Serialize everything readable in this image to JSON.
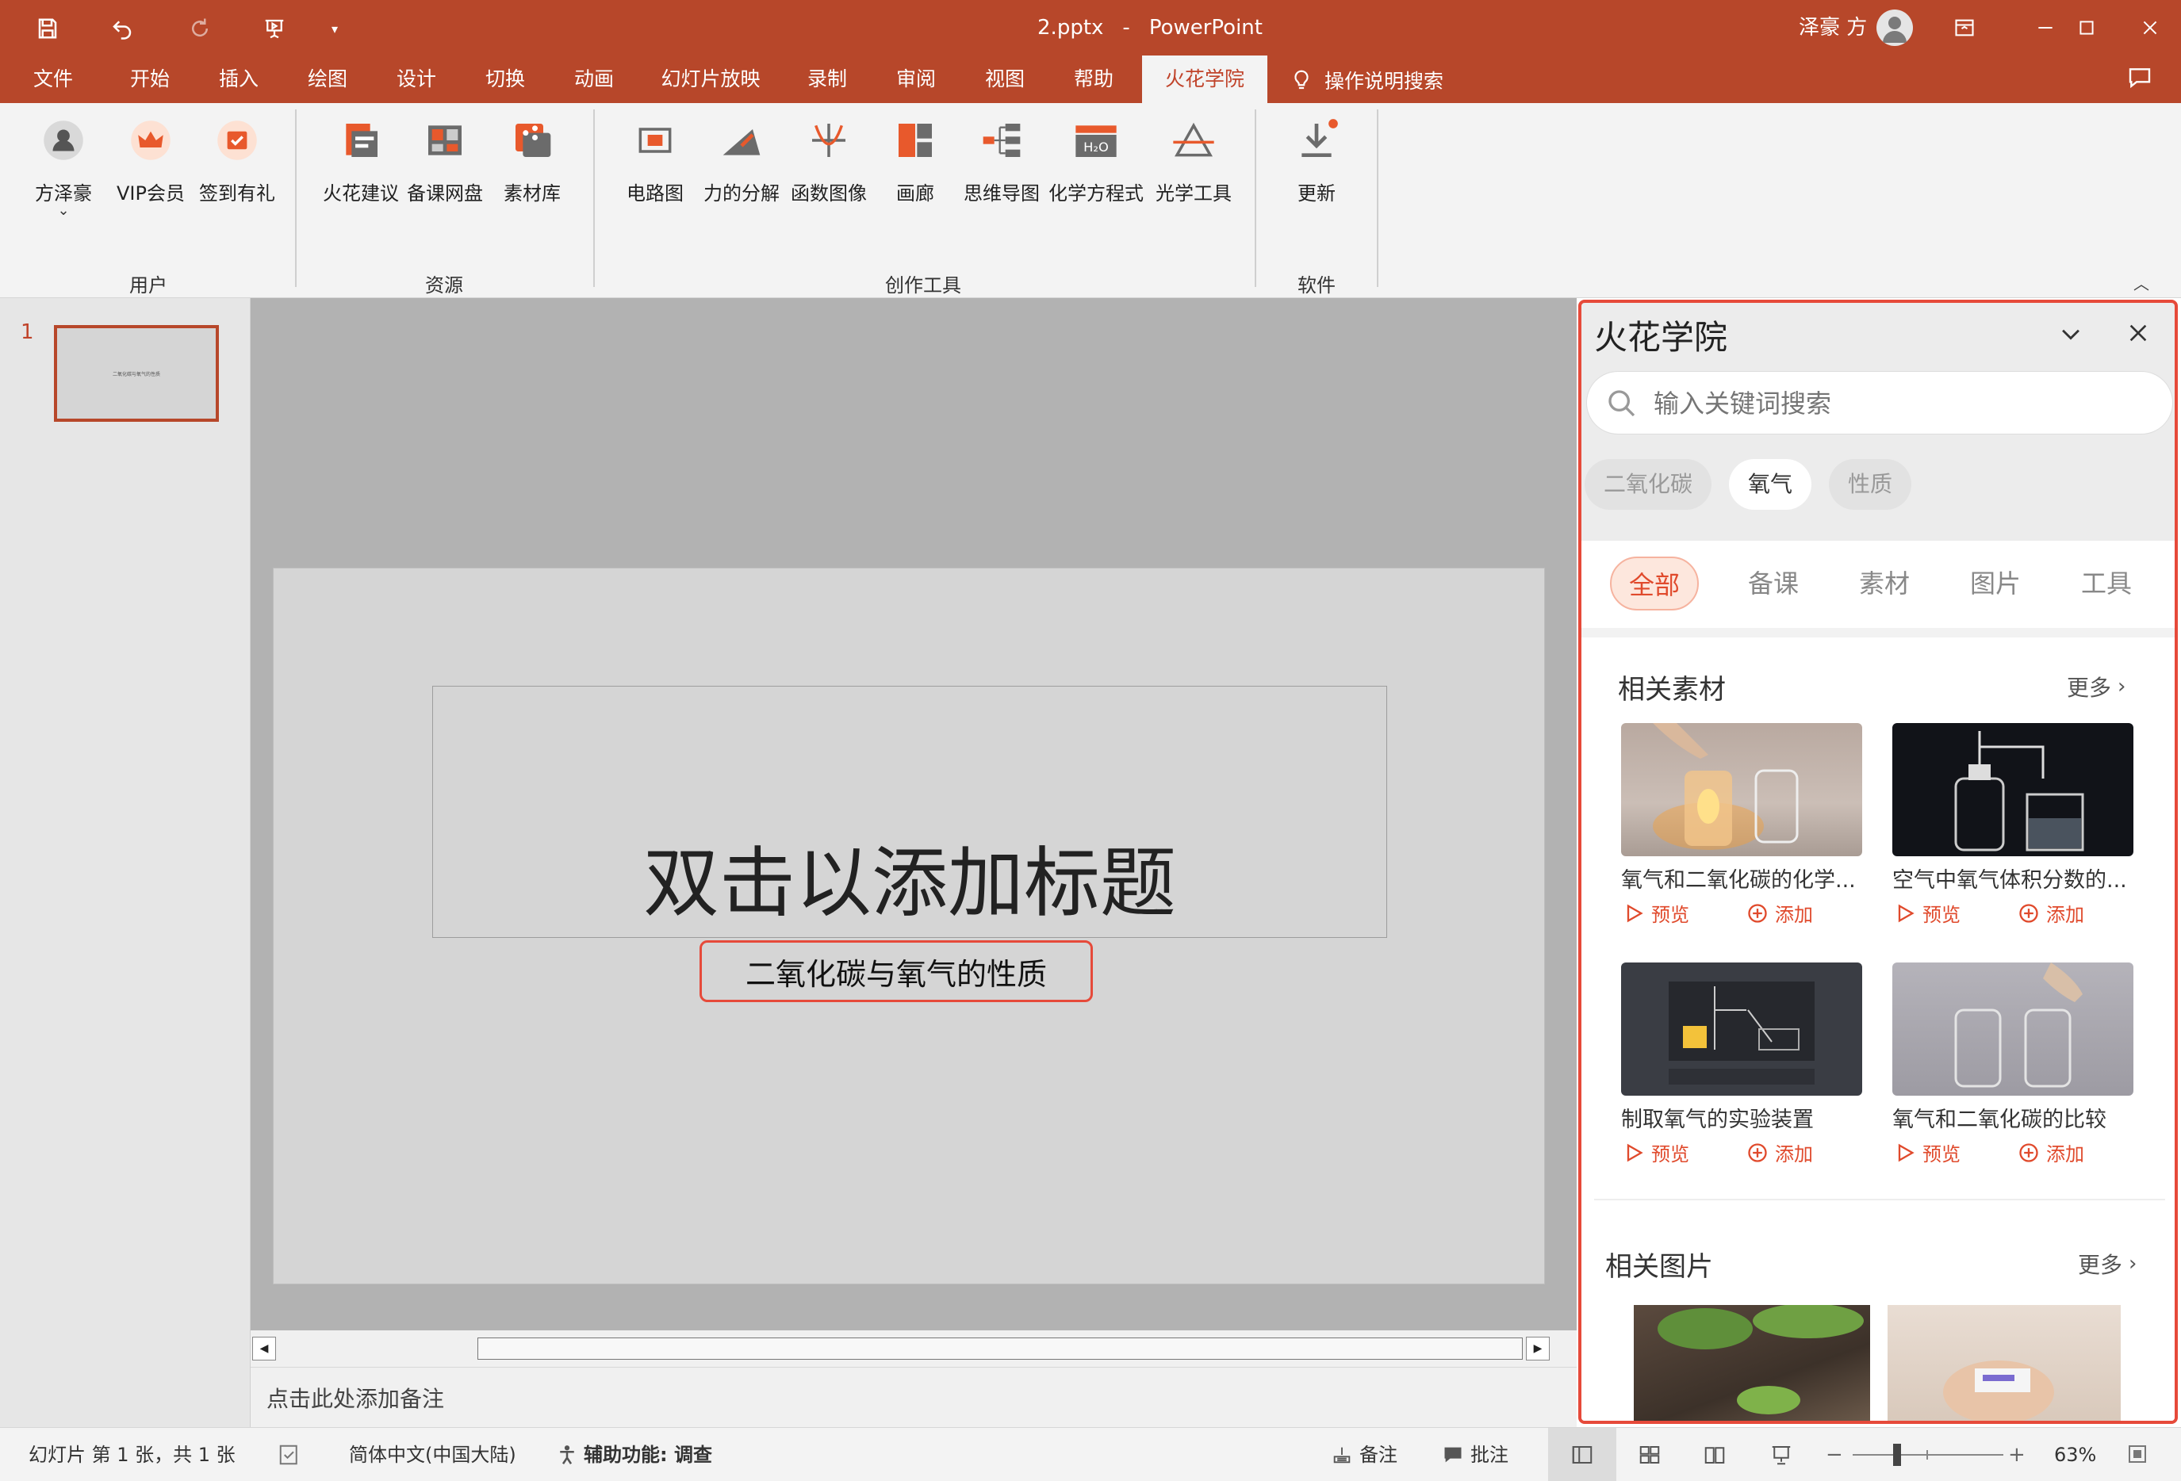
{
  "window": {
    "file_name": "2.pptx",
    "separator": "-",
    "app_name": "PowerPoint",
    "user_name": "泽豪 方"
  },
  "tabs": [
    {
      "label": "文件"
    },
    {
      "label": "开始"
    },
    {
      "label": "插入"
    },
    {
      "label": "绘图"
    },
    {
      "label": "设计"
    },
    {
      "label": "切换"
    },
    {
      "label": "动画"
    },
    {
      "label": "幻灯片放映"
    },
    {
      "label": "录制"
    },
    {
      "label": "审阅"
    },
    {
      "label": "视图"
    },
    {
      "label": "帮助"
    },
    {
      "label": "火花学院"
    }
  ],
  "tell_me": "操作说明搜索",
  "ribbon": {
    "user_group": {
      "label": "用户",
      "items": [
        "方泽豪",
        "VIP会员",
        "签到有礼"
      ]
    },
    "resource_group": {
      "label": "资源",
      "items": [
        "火花建议",
        "备课网盘",
        "素材库"
      ]
    },
    "tools_group": {
      "label": "创作工具",
      "items": [
        "电路图",
        "力的分解",
        "函数图像",
        "画廊",
        "思维导图",
        "化学方程式",
        "光学工具"
      ]
    },
    "software_group": {
      "label": "软件",
      "items": [
        "更新"
      ]
    },
    "h2o_text": "H₂O"
  },
  "thumbnails": [
    {
      "number": "1",
      "caption": "二氧化碳与氧气的性质"
    }
  ],
  "slide": {
    "title_placeholder": "双击以添加标题",
    "subtitle": "二氧化碳与氧气的性质"
  },
  "notes_placeholder": "点击此处添加备注",
  "status": {
    "slide_info": "幻灯片 第 1 张，共 1 张",
    "language": "简体中文(中国大陆)",
    "accessibility": "辅助功能: 调查",
    "notes_btn": "备注",
    "comments_btn": "批注",
    "zoom": "63%",
    "zoom_fraction": 0.63
  },
  "pane": {
    "title": "火花学院",
    "search_placeholder": "输入关键词搜索",
    "keywords": [
      "二氧化碳",
      "氧气",
      "性质"
    ],
    "selected_keyword": "氧气",
    "filter_tabs": [
      "全部",
      "备课",
      "素材",
      "图片",
      "工具"
    ],
    "active_filter": "全部",
    "related_materials": {
      "title": "相关素材",
      "more": "更多",
      "items": [
        {
          "title": "氧气和二氧化碳的化学...",
          "preview": "预览",
          "add": "添加"
        },
        {
          "title": "空气中氧气体积分数的...",
          "preview": "预览",
          "add": "添加"
        },
        {
          "title": "制取氧气的实验装置",
          "preview": "预览",
          "add": "添加"
        },
        {
          "title": "氧气和二氧化碳的比较",
          "preview": "预览",
          "add": "添加"
        }
      ]
    },
    "related_images": {
      "title": "相关图片",
      "more": "更多"
    }
  },
  "colors": {
    "accent": "#b7472a",
    "pane_accent": "#e04a2c",
    "highlight_border": "#e64a3a"
  }
}
